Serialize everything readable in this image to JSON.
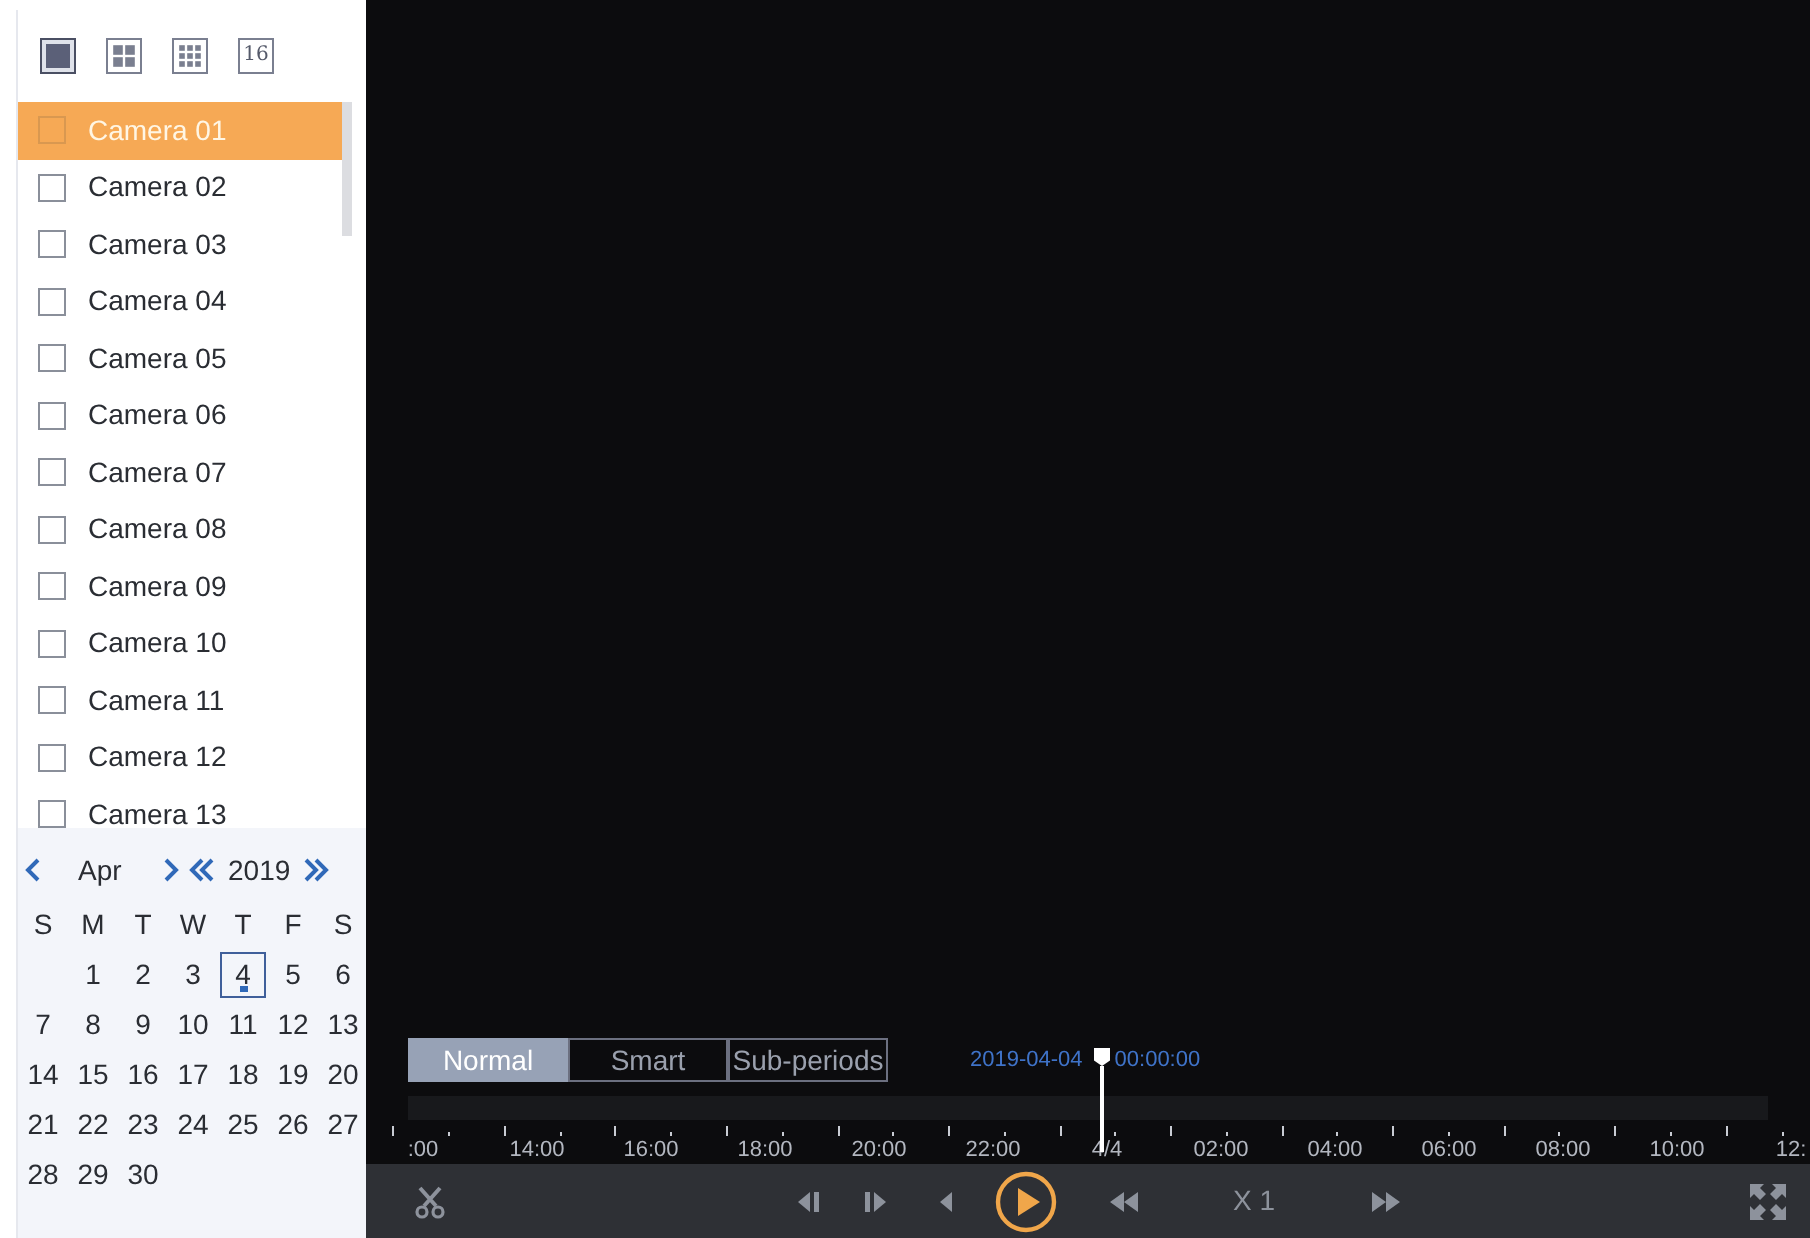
{
  "layouts": [
    {
      "kind": "single",
      "selected": true
    },
    {
      "kind": "quad",
      "selected": false
    },
    {
      "kind": "nine",
      "selected": false
    },
    {
      "kind": "sixteen",
      "selected": false,
      "label": "16"
    }
  ],
  "cameras": [
    {
      "name": "Camera 01",
      "selected": true,
      "checked": false
    },
    {
      "name": "Camera 02",
      "selected": false,
      "checked": false
    },
    {
      "name": "Camera 03",
      "selected": false,
      "checked": false
    },
    {
      "name": "Camera 04",
      "selected": false,
      "checked": false
    },
    {
      "name": "Camera 05",
      "selected": false,
      "checked": false
    },
    {
      "name": "Camera 06",
      "selected": false,
      "checked": false
    },
    {
      "name": "Camera 07",
      "selected": false,
      "checked": false
    },
    {
      "name": "Camera 08",
      "selected": false,
      "checked": false
    },
    {
      "name": "Camera 09",
      "selected": false,
      "checked": false
    },
    {
      "name": "Camera 10",
      "selected": false,
      "checked": false
    },
    {
      "name": "Camera 11",
      "selected": false,
      "checked": false
    },
    {
      "name": "Camera 12",
      "selected": false,
      "checked": false
    },
    {
      "name": "Camera 13",
      "selected": false,
      "checked": false
    }
  ],
  "calendar": {
    "month": "Apr",
    "year": "2019",
    "weekdays": [
      "S",
      "M",
      "T",
      "W",
      "T",
      "F",
      "S"
    ],
    "days": [
      {
        "day": "1",
        "selected": false,
        "recorded": false
      },
      {
        "day": "2",
        "selected": false,
        "recorded": false
      },
      {
        "day": "3",
        "selected": false,
        "recorded": false
      },
      {
        "day": "4",
        "selected": true,
        "recorded": true
      },
      {
        "day": "5",
        "selected": false,
        "recorded": false
      },
      {
        "day": "6",
        "selected": false,
        "recorded": false
      },
      {
        "day": "7",
        "selected": false,
        "recorded": false
      },
      {
        "day": "8",
        "selected": false,
        "recorded": false
      },
      {
        "day": "9",
        "selected": false,
        "recorded": false
      },
      {
        "day": "10",
        "selected": false,
        "recorded": false
      },
      {
        "day": "11",
        "selected": false,
        "recorded": false
      },
      {
        "day": "12",
        "selected": false,
        "recorded": false
      },
      {
        "day": "13",
        "selected": false,
        "recorded": false
      },
      {
        "day": "14",
        "selected": false,
        "recorded": false
      },
      {
        "day": "15",
        "selected": false,
        "recorded": false
      },
      {
        "day": "16",
        "selected": false,
        "recorded": false
      },
      {
        "day": "17",
        "selected": false,
        "recorded": false
      },
      {
        "day": "18",
        "selected": false,
        "recorded": false
      },
      {
        "day": "19",
        "selected": false,
        "recorded": false
      },
      {
        "day": "20",
        "selected": false,
        "recorded": false
      },
      {
        "day": "21",
        "selected": false,
        "recorded": false
      },
      {
        "day": "22",
        "selected": false,
        "recorded": false
      },
      {
        "day": "23",
        "selected": false,
        "recorded": false
      },
      {
        "day": "24",
        "selected": false,
        "recorded": false
      },
      {
        "day": "25",
        "selected": false,
        "recorded": false
      },
      {
        "day": "26",
        "selected": false,
        "recorded": false
      },
      {
        "day": "27",
        "selected": false,
        "recorded": false
      },
      {
        "day": "28",
        "selected": false,
        "recorded": false
      },
      {
        "day": "29",
        "selected": false,
        "recorded": false
      },
      {
        "day": "30",
        "selected": false,
        "recorded": false
      }
    ]
  },
  "modes": [
    {
      "label": "Normal",
      "selected": true
    },
    {
      "label": "Smart",
      "selected": false
    },
    {
      "label": "Sub-periods",
      "selected": false
    }
  ],
  "cursor_date": "2019-04-04",
  "cursor_time": "00:00:00",
  "timeline_labels": [
    ":00",
    "14:00",
    "16:00",
    "18:00",
    "20:00",
    "22:00",
    "4/4",
    "02:00",
    "04:00",
    "06:00",
    "08:00",
    "10:00",
    "12:"
  ],
  "controls": [
    {
      "kind": "clip"
    },
    {
      "kind": "spacer"
    },
    {
      "kind": "prev-frame"
    },
    {
      "kind": "next-frame"
    },
    {
      "kind": "reverse"
    },
    {
      "kind": "play"
    },
    {
      "kind": "slow"
    },
    {
      "kind": "speed",
      "label": "X 1"
    },
    {
      "kind": "fast"
    },
    {
      "kind": "spacer"
    },
    {
      "kind": "fullscreen"
    }
  ]
}
